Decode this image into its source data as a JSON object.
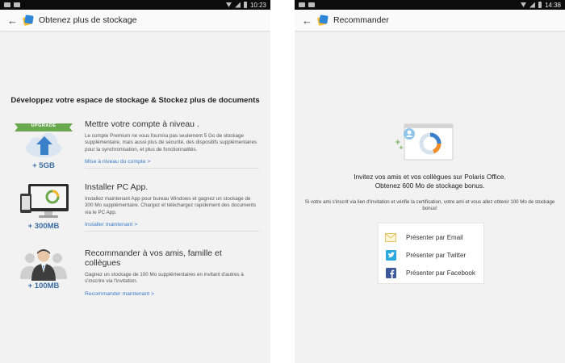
{
  "left": {
    "status_time": "10:23",
    "title": "Obtenez plus de stockage",
    "heading": "Développez votre espace de stockage & Stockez plus de documents",
    "features": [
      {
        "badge": "UPGRADE",
        "amount": "+ 5GB",
        "title": "Mettre votre compte à niveau .",
        "desc": "Le compte Premium ne vous fournira pas seulement 5 Go de stockage supplémentaire, mais aussi plus de sécurité, des dispositifs supplémentaires pour la synchronisation, et plus de fonctionnalités.",
        "link": "Mise à niveau du compte >"
      },
      {
        "amount": "+ 300MB",
        "title": "Installer PC App.",
        "desc": "Installez maintenant App pour bureau Windows et gagnez un stockage de 300 Mo supplémentaire. Chargez et téléchargez rapidement des documents via le PC App.",
        "link": "Installer maintenant >"
      },
      {
        "amount": "+ 100MB",
        "title": "Recommander à vos amis, famille et collègues",
        "desc": "Gagnez un stockage de 100 Mo supplémentaires en invitant d'autres à s'inscrire via l'invitation.",
        "link": "Recommander maintenant >"
      }
    ]
  },
  "right": {
    "status_time": "14:38",
    "title": "Recommander",
    "headline_1": "Invitez vos amis et vos collègues sur Polaris Office.",
    "headline_2": "Obtenez 600 Mo de stockage bonus.",
    "desc": "Si votre ami s'inscrit via lien d'invitation et vérifie la certification, votre ami et vous allez obtenir 100 Mo de stockage bonus!",
    "share": [
      {
        "label": "Présenter par Email",
        "icon": "mail-icon"
      },
      {
        "label": "Présenter par Twitter",
        "icon": "twitter-icon"
      },
      {
        "label": "Présenter par Facebook",
        "icon": "facebook-icon"
      }
    ]
  },
  "colors": {
    "accent_link": "#3a7bc8",
    "amount_blue": "#3a6ea5",
    "twitter": "#2aa9e0",
    "facebook": "#3b5998",
    "upgrade_green": "#6aa84f"
  }
}
